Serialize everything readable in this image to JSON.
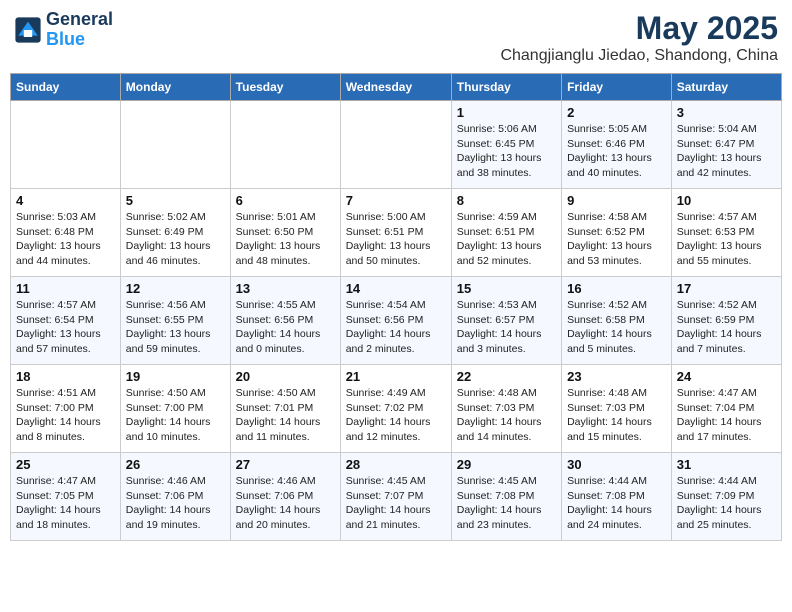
{
  "header": {
    "logo_line1": "General",
    "logo_line2": "Blue",
    "title": "May 2025",
    "subtitle": "Changjianglu Jiedao, Shandong, China"
  },
  "weekdays": [
    "Sunday",
    "Monday",
    "Tuesday",
    "Wednesday",
    "Thursday",
    "Friday",
    "Saturday"
  ],
  "weeks": [
    [
      {
        "day": "",
        "detail": ""
      },
      {
        "day": "",
        "detail": ""
      },
      {
        "day": "",
        "detail": ""
      },
      {
        "day": "",
        "detail": ""
      },
      {
        "day": "1",
        "detail": "Sunrise: 5:06 AM\nSunset: 6:45 PM\nDaylight: 13 hours\nand 38 minutes."
      },
      {
        "day": "2",
        "detail": "Sunrise: 5:05 AM\nSunset: 6:46 PM\nDaylight: 13 hours\nand 40 minutes."
      },
      {
        "day": "3",
        "detail": "Sunrise: 5:04 AM\nSunset: 6:47 PM\nDaylight: 13 hours\nand 42 minutes."
      }
    ],
    [
      {
        "day": "4",
        "detail": "Sunrise: 5:03 AM\nSunset: 6:48 PM\nDaylight: 13 hours\nand 44 minutes."
      },
      {
        "day": "5",
        "detail": "Sunrise: 5:02 AM\nSunset: 6:49 PM\nDaylight: 13 hours\nand 46 minutes."
      },
      {
        "day": "6",
        "detail": "Sunrise: 5:01 AM\nSunset: 6:50 PM\nDaylight: 13 hours\nand 48 minutes."
      },
      {
        "day": "7",
        "detail": "Sunrise: 5:00 AM\nSunset: 6:51 PM\nDaylight: 13 hours\nand 50 minutes."
      },
      {
        "day": "8",
        "detail": "Sunrise: 4:59 AM\nSunset: 6:51 PM\nDaylight: 13 hours\nand 52 minutes."
      },
      {
        "day": "9",
        "detail": "Sunrise: 4:58 AM\nSunset: 6:52 PM\nDaylight: 13 hours\nand 53 minutes."
      },
      {
        "day": "10",
        "detail": "Sunrise: 4:57 AM\nSunset: 6:53 PM\nDaylight: 13 hours\nand 55 minutes."
      }
    ],
    [
      {
        "day": "11",
        "detail": "Sunrise: 4:57 AM\nSunset: 6:54 PM\nDaylight: 13 hours\nand 57 minutes."
      },
      {
        "day": "12",
        "detail": "Sunrise: 4:56 AM\nSunset: 6:55 PM\nDaylight: 13 hours\nand 59 minutes."
      },
      {
        "day": "13",
        "detail": "Sunrise: 4:55 AM\nSunset: 6:56 PM\nDaylight: 14 hours\nand 0 minutes."
      },
      {
        "day": "14",
        "detail": "Sunrise: 4:54 AM\nSunset: 6:56 PM\nDaylight: 14 hours\nand 2 minutes."
      },
      {
        "day": "15",
        "detail": "Sunrise: 4:53 AM\nSunset: 6:57 PM\nDaylight: 14 hours\nand 3 minutes."
      },
      {
        "day": "16",
        "detail": "Sunrise: 4:52 AM\nSunset: 6:58 PM\nDaylight: 14 hours\nand 5 minutes."
      },
      {
        "day": "17",
        "detail": "Sunrise: 4:52 AM\nSunset: 6:59 PM\nDaylight: 14 hours\nand 7 minutes."
      }
    ],
    [
      {
        "day": "18",
        "detail": "Sunrise: 4:51 AM\nSunset: 7:00 PM\nDaylight: 14 hours\nand 8 minutes."
      },
      {
        "day": "19",
        "detail": "Sunrise: 4:50 AM\nSunset: 7:00 PM\nDaylight: 14 hours\nand 10 minutes."
      },
      {
        "day": "20",
        "detail": "Sunrise: 4:50 AM\nSunset: 7:01 PM\nDaylight: 14 hours\nand 11 minutes."
      },
      {
        "day": "21",
        "detail": "Sunrise: 4:49 AM\nSunset: 7:02 PM\nDaylight: 14 hours\nand 12 minutes."
      },
      {
        "day": "22",
        "detail": "Sunrise: 4:48 AM\nSunset: 7:03 PM\nDaylight: 14 hours\nand 14 minutes."
      },
      {
        "day": "23",
        "detail": "Sunrise: 4:48 AM\nSunset: 7:03 PM\nDaylight: 14 hours\nand 15 minutes."
      },
      {
        "day": "24",
        "detail": "Sunrise: 4:47 AM\nSunset: 7:04 PM\nDaylight: 14 hours\nand 17 minutes."
      }
    ],
    [
      {
        "day": "25",
        "detail": "Sunrise: 4:47 AM\nSunset: 7:05 PM\nDaylight: 14 hours\nand 18 minutes."
      },
      {
        "day": "26",
        "detail": "Sunrise: 4:46 AM\nSunset: 7:06 PM\nDaylight: 14 hours\nand 19 minutes."
      },
      {
        "day": "27",
        "detail": "Sunrise: 4:46 AM\nSunset: 7:06 PM\nDaylight: 14 hours\nand 20 minutes."
      },
      {
        "day": "28",
        "detail": "Sunrise: 4:45 AM\nSunset: 7:07 PM\nDaylight: 14 hours\nand 21 minutes."
      },
      {
        "day": "29",
        "detail": "Sunrise: 4:45 AM\nSunset: 7:08 PM\nDaylight: 14 hours\nand 23 minutes."
      },
      {
        "day": "30",
        "detail": "Sunrise: 4:44 AM\nSunset: 7:08 PM\nDaylight: 14 hours\nand 24 minutes."
      },
      {
        "day": "31",
        "detail": "Sunrise: 4:44 AM\nSunset: 7:09 PM\nDaylight: 14 hours\nand 25 minutes."
      }
    ]
  ]
}
